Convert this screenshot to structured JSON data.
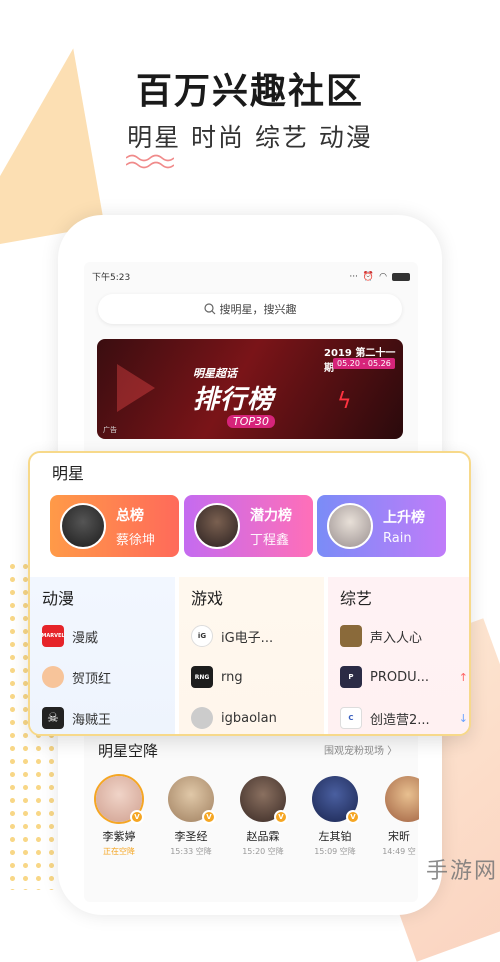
{
  "headline": "百万兴趣社区",
  "subline": "明星 时尚 综艺 动漫",
  "status": {
    "time": "下午5:23"
  },
  "search": {
    "placeholder": "搜明星，搜兴趣"
  },
  "banner": {
    "year_label": "2019 第二十一期",
    "date_range": "05.20 - 05.26",
    "subtitle": "明星超话",
    "main": "排行榜",
    "top": "TOP30",
    "ad": "广告"
  },
  "card": {
    "title": "明星",
    "ranks": [
      {
        "label": "总榜",
        "name": "蔡徐坤"
      },
      {
        "label": "潜力榜",
        "name": "丁程鑫"
      },
      {
        "label": "上升榜",
        "name": "Rain"
      }
    ],
    "columns": [
      {
        "title": "动漫",
        "items": [
          {
            "name": "漫威",
            "icon": "marvel-icon",
            "color": "#e62429",
            "icon_text": "MARVEL"
          },
          {
            "name": "贺顶红",
            "icon": "cartoon-face-icon",
            "color": "#f7c49a",
            "icon_text": ""
          },
          {
            "name": "海贼王",
            "icon": "skull-icon",
            "color": "#222222",
            "icon_text": "☠"
          }
        ]
      },
      {
        "title": "游戏",
        "items": [
          {
            "name": "iG电子...",
            "icon": "ig-logo-icon",
            "color": "#333333",
            "icon_text": "iG"
          },
          {
            "name": "rng",
            "icon": "rng-logo-icon",
            "color": "#1d1d1d",
            "icon_text": "RNG"
          },
          {
            "name": "igbaolan",
            "icon": "avatar-icon",
            "color": "#cccccc",
            "icon_text": ""
          }
        ]
      },
      {
        "title": "综艺",
        "items": [
          {
            "name": "声入人心",
            "icon": "show-poster-icon",
            "color": "#8a6a3a",
            "icon_text": ""
          },
          {
            "name": "PRODU...",
            "icon": "produce-logo-icon",
            "color": "#2b2b45",
            "icon_text": "P",
            "trend": "↑"
          },
          {
            "name": "创造营2...",
            "icon": "chuang-logo-icon",
            "color": "#3a5fbf",
            "icon_text": "C",
            "trend": "↓"
          }
        ]
      }
    ]
  },
  "drop": {
    "title": "明星空降",
    "more": "围观宠粉现场 〉",
    "people": [
      {
        "name": "李紫婷",
        "time": "正在空降",
        "live": true,
        "color": "#e0b8a8"
      },
      {
        "name": "李圣经",
        "time": "15:33 空降",
        "live": false,
        "color": "#c9a98a"
      },
      {
        "name": "赵品霖",
        "time": "15:20 空降",
        "live": false,
        "color": "#6b5548"
      },
      {
        "name": "左其铂",
        "time": "15:09 空降",
        "live": false,
        "color": "#2c3f7a"
      },
      {
        "name": "宋昕",
        "time": "14:49 空",
        "live": false,
        "color": "#d0a070"
      }
    ]
  },
  "watermark": "手游网"
}
